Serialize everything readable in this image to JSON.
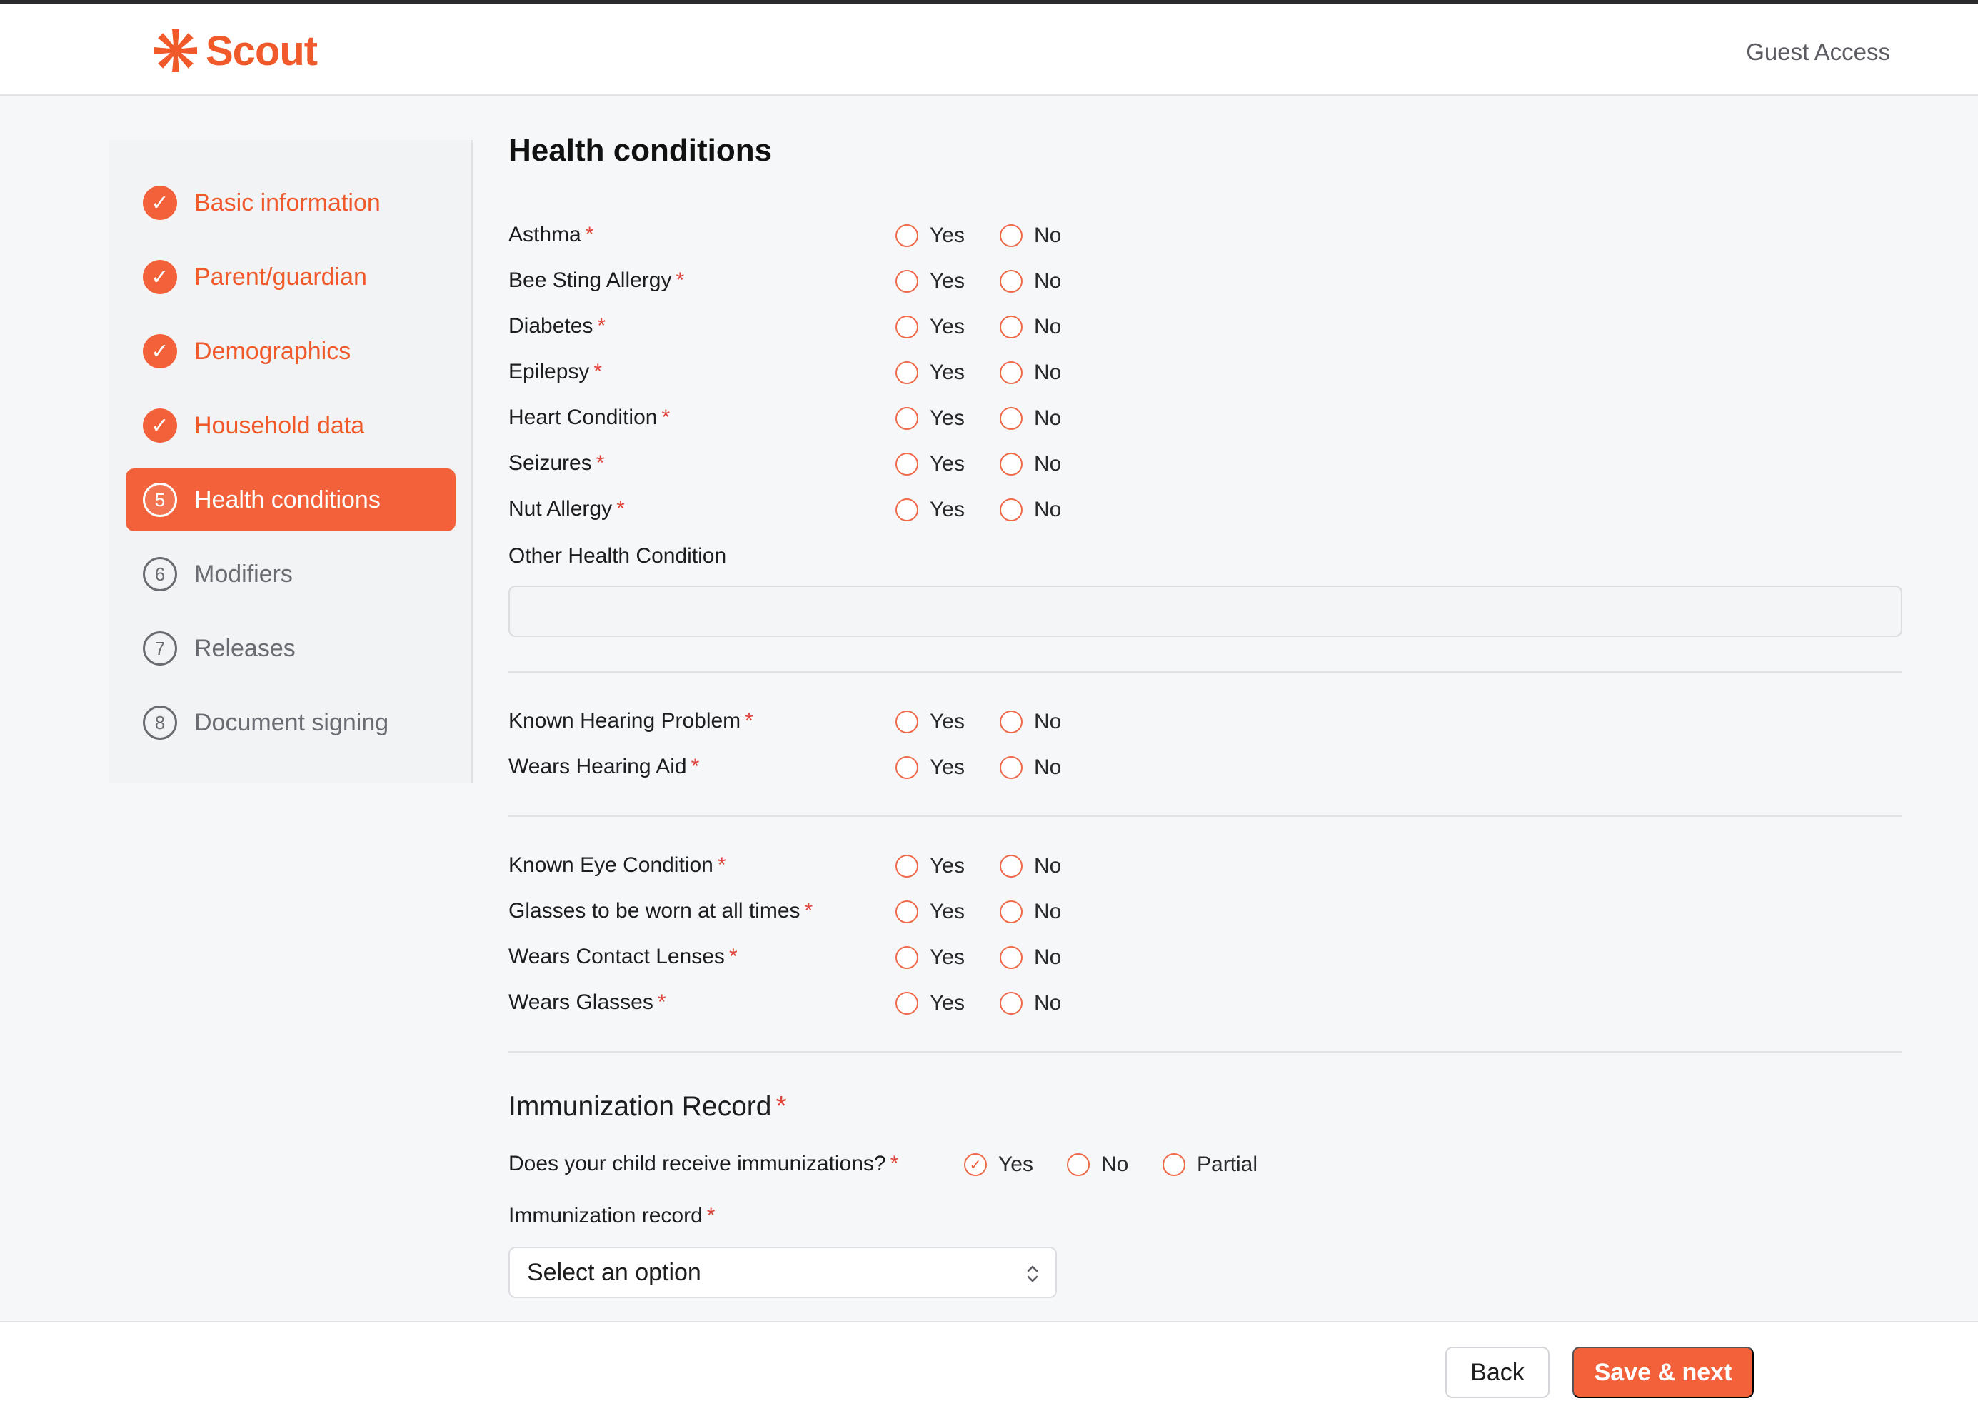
{
  "header": {
    "brand": "Scout",
    "guest": "Guest Access"
  },
  "colors": {
    "accent": "#f2613a",
    "required": "#e0453d"
  },
  "sidebar": {
    "steps": [
      {
        "label": "Basic information",
        "status": "done",
        "icon": "check-icon"
      },
      {
        "label": "Parent/guardian",
        "status": "done",
        "icon": "check-icon"
      },
      {
        "label": "Demographics",
        "status": "done",
        "icon": "check-icon"
      },
      {
        "label": "Household data",
        "status": "done",
        "icon": "check-icon"
      },
      {
        "label": "Health conditions",
        "number": "5",
        "status": "active"
      },
      {
        "label": "Modifiers",
        "number": "6",
        "status": "todo"
      },
      {
        "label": "Releases",
        "number": "7",
        "status": "todo"
      },
      {
        "label": "Document signing",
        "number": "8",
        "status": "todo"
      }
    ]
  },
  "main": {
    "title": "Health conditions",
    "yes": "Yes",
    "no": "No",
    "partial": "Partial",
    "req": "*",
    "questions": [
      "Asthma",
      "Bee Sting Allergy",
      "Diabetes",
      "Epilepsy",
      "Heart Condition",
      "Seizures",
      "Nut Allergy"
    ],
    "other_label": "Other Health Condition",
    "other_value": "",
    "hearing": [
      "Known Hearing Problem",
      "Wears Hearing Aid"
    ],
    "eye": [
      "Known Eye Condition",
      "Glasses to be worn at all times",
      "Wears Contact Lenses",
      "Wears Glasses"
    ],
    "immunization": {
      "title": "Immunization Record",
      "question": "Does your child receive immunizations?",
      "selected": "Yes",
      "record_label": "Immunization record",
      "select_value": "Select an option"
    }
  },
  "footer": {
    "back": "Back",
    "next": "Save & next"
  }
}
